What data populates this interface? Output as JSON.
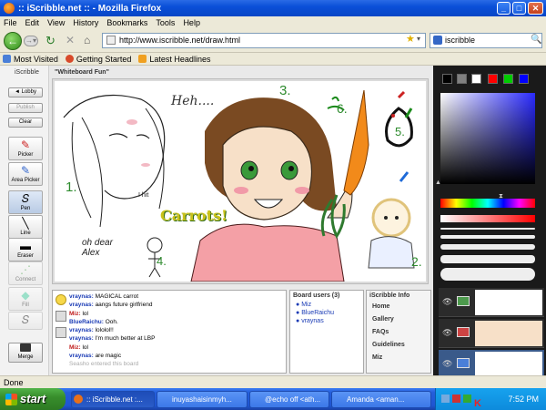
{
  "window": {
    "title": ":: iScribble.net :: - Mozilla Firefox"
  },
  "menu": [
    "File",
    "Edit",
    "View",
    "History",
    "Bookmarks",
    "Tools",
    "Help"
  ],
  "nav": {
    "url": "http://www.iscribble.net/draw.html",
    "search_value": "iscribble"
  },
  "bookmarks": [
    "Most Visited",
    "Getting Started",
    "Latest Headlines"
  ],
  "app": {
    "brand": "iScribble",
    "buttons": {
      "lobby": "◄ Lobby",
      "publish": "Publish",
      "clear": "Clear",
      "merge": "Merge"
    },
    "tools": [
      "Picker",
      "Area Picker",
      "Pen",
      "Line",
      "Eraser",
      "Connect",
      "Fill"
    ],
    "board_title": "\"Whiteboard Fun\"",
    "canvas_text": [
      "Heh....",
      "3.",
      "6.",
      "5.",
      "1.",
      "2.",
      "4.",
      "Carrots!",
      "oh dear Alex",
      "I hit"
    ]
  },
  "chat": {
    "messages": [
      {
        "nick": "vraynas:",
        "text": "MAGICAL carrot"
      },
      {
        "nick": "vraynas:",
        "text": "aangs future girlfriend"
      },
      {
        "nick": "Miz:",
        "text": "lol"
      },
      {
        "nick": "BlueRaichu:",
        "text": "Ooh."
      },
      {
        "nick": "vraynas:",
        "text": "lololol!!"
      },
      {
        "nick": "vraynas:",
        "text": "I'm much better at LBP"
      },
      {
        "nick": "Miz:",
        "text": "lol"
      },
      {
        "nick": "vraynas:",
        "text": "are magic"
      },
      {
        "nick": "",
        "text": "Seasho entered this board"
      }
    ]
  },
  "users": {
    "header": "Board users (3)",
    "list": [
      "Miz",
      "BlueRaichu",
      "vraynas"
    ]
  },
  "info": {
    "header": "iScribble Info",
    "links": [
      "Home",
      "Gallery",
      "FAQs",
      "Guidelines",
      "Miz"
    ]
  },
  "palette": [
    "#000000",
    "#808080",
    "#ffffff",
    "#ff0000",
    "#00cc00",
    "#0000ff"
  ],
  "status": {
    "text": "Done"
  },
  "taskbar": {
    "start": "start",
    "tasks": [
      ":: iScribble.net :...",
      "inuyashaisinmyh...",
      "@echo off <ath...",
      "Amanda <aman..."
    ],
    "clock": "7:52 PM"
  }
}
